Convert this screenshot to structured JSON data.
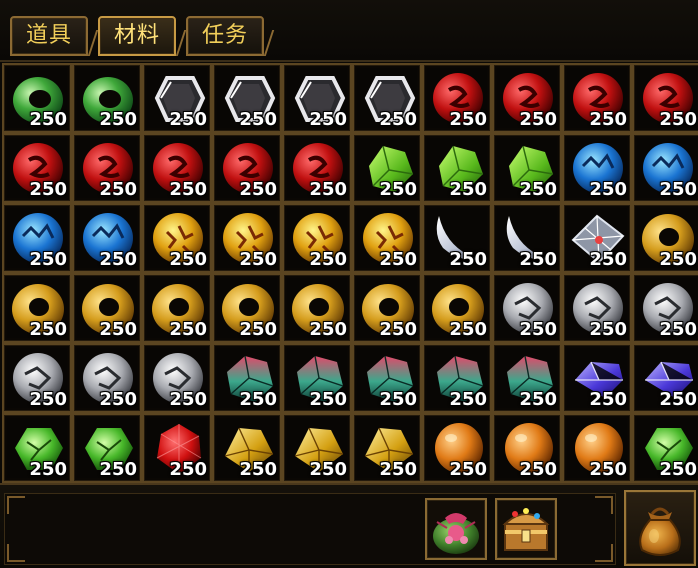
{
  "tabs": [
    {
      "label": "道具",
      "active": false
    },
    {
      "label": "材料",
      "active": true
    },
    {
      "label": "任务",
      "active": false
    }
  ],
  "inventory": {
    "columns": 10,
    "rows": 6,
    "slots": [
      {
        "item": "jade-ring",
        "qty": "250"
      },
      {
        "item": "jade-ring",
        "qty": "250"
      },
      {
        "item": "dark-crystal",
        "qty": "250"
      },
      {
        "item": "dark-crystal",
        "qty": "250"
      },
      {
        "item": "dark-crystal",
        "qty": "250"
      },
      {
        "item": "dark-crystal",
        "qty": "250"
      },
      {
        "item": "red-orb",
        "qty": "250"
      },
      {
        "item": "red-orb",
        "qty": "250"
      },
      {
        "item": "red-orb",
        "qty": "250"
      },
      {
        "item": "red-orb",
        "qty": "250"
      },
      {
        "item": "red-orb",
        "qty": "250"
      },
      {
        "item": "red-orb",
        "qty": "250"
      },
      {
        "item": "red-orb",
        "qty": "250"
      },
      {
        "item": "red-orb",
        "qty": "250"
      },
      {
        "item": "red-orb",
        "qty": "250"
      },
      {
        "item": "green-crystal",
        "qty": "250"
      },
      {
        "item": "green-crystal",
        "qty": "250"
      },
      {
        "item": "green-crystal",
        "qty": "250"
      },
      {
        "item": "blue-orb",
        "qty": "250"
      },
      {
        "item": "blue-orb",
        "qty": "250"
      },
      {
        "item": "blue-orb",
        "qty": "250"
      },
      {
        "item": "blue-orb",
        "qty": "250"
      },
      {
        "item": "gold-orb",
        "qty": "250"
      },
      {
        "item": "gold-orb",
        "qty": "250"
      },
      {
        "item": "gold-orb",
        "qty": "250"
      },
      {
        "item": "gold-orb",
        "qty": "250"
      },
      {
        "item": "silver-fang",
        "qty": "250"
      },
      {
        "item": "silver-fang",
        "qty": "250"
      },
      {
        "item": "diamond-shard",
        "qty": "250"
      },
      {
        "item": "gold-ring",
        "qty": "250"
      },
      {
        "item": "gold-ring",
        "qty": "250"
      },
      {
        "item": "gold-ring",
        "qty": "250"
      },
      {
        "item": "gold-ring",
        "qty": "250"
      },
      {
        "item": "gold-ring",
        "qty": "250"
      },
      {
        "item": "gold-ring",
        "qty": "250"
      },
      {
        "item": "gold-ring",
        "qty": "250"
      },
      {
        "item": "gold-ring",
        "qty": "250"
      },
      {
        "item": "white-orb",
        "qty": "250"
      },
      {
        "item": "white-orb",
        "qty": "250"
      },
      {
        "item": "white-orb",
        "qty": "250"
      },
      {
        "item": "white-orb",
        "qty": "250"
      },
      {
        "item": "white-orb",
        "qty": "250"
      },
      {
        "item": "white-orb",
        "qty": "250"
      },
      {
        "item": "rose-crystal",
        "qty": "250"
      },
      {
        "item": "rose-crystal",
        "qty": "250"
      },
      {
        "item": "rose-crystal",
        "qty": "250"
      },
      {
        "item": "rose-crystal",
        "qty": "250"
      },
      {
        "item": "rose-crystal",
        "qty": "250"
      },
      {
        "item": "sapphire",
        "qty": "250"
      },
      {
        "item": "sapphire",
        "qty": "250"
      },
      {
        "item": "green-gem",
        "qty": "250"
      },
      {
        "item": "green-gem",
        "qty": "250"
      },
      {
        "item": "ruby",
        "qty": "250"
      },
      {
        "item": "gold-gem",
        "qty": "250"
      },
      {
        "item": "gold-gem",
        "qty": "250"
      },
      {
        "item": "gold-gem",
        "qty": "250"
      },
      {
        "item": "amber-egg",
        "qty": "250"
      },
      {
        "item": "amber-egg",
        "qty": "250"
      },
      {
        "item": "amber-egg",
        "qty": "250"
      },
      {
        "item": "green-gem",
        "qty": "250"
      }
    ]
  },
  "bottom_bar": {
    "quick_slots": [
      {
        "icon": "gift-bundle-icon"
      },
      {
        "icon": "treasure-chest-icon"
      }
    ],
    "bag_button": {
      "icon": "coin-bag-icon"
    }
  },
  "colors": {
    "frame_gold": "#8c6a33",
    "tab_text": "#f2cf5a",
    "cell_border": "#5b4521",
    "quantity_text": "#ffffff"
  }
}
